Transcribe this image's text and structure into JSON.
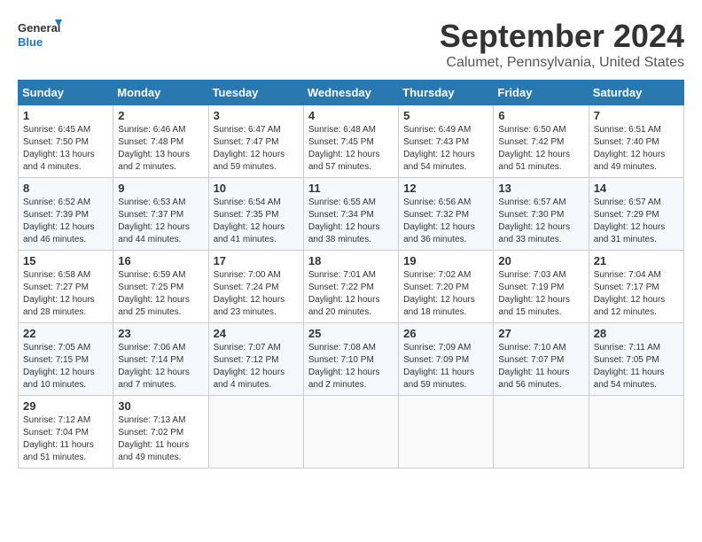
{
  "logo": {
    "line1": "General",
    "line2": "Blue"
  },
  "title": "September 2024",
  "location": "Calumet, Pennsylvania, United States",
  "days_of_week": [
    "Sunday",
    "Monday",
    "Tuesday",
    "Wednesday",
    "Thursday",
    "Friday",
    "Saturday"
  ],
  "weeks": [
    [
      {
        "day": "1",
        "sunrise": "6:45 AM",
        "sunset": "7:50 PM",
        "daylight": "13 hours and 4 minutes."
      },
      {
        "day": "2",
        "sunrise": "6:46 AM",
        "sunset": "7:48 PM",
        "daylight": "13 hours and 2 minutes."
      },
      {
        "day": "3",
        "sunrise": "6:47 AM",
        "sunset": "7:47 PM",
        "daylight": "12 hours and 59 minutes."
      },
      {
        "day": "4",
        "sunrise": "6:48 AM",
        "sunset": "7:45 PM",
        "daylight": "12 hours and 57 minutes."
      },
      {
        "day": "5",
        "sunrise": "6:49 AM",
        "sunset": "7:43 PM",
        "daylight": "12 hours and 54 minutes."
      },
      {
        "day": "6",
        "sunrise": "6:50 AM",
        "sunset": "7:42 PM",
        "daylight": "12 hours and 51 minutes."
      },
      {
        "day": "7",
        "sunrise": "6:51 AM",
        "sunset": "7:40 PM",
        "daylight": "12 hours and 49 minutes."
      }
    ],
    [
      {
        "day": "8",
        "sunrise": "6:52 AM",
        "sunset": "7:39 PM",
        "daylight": "12 hours and 46 minutes."
      },
      {
        "day": "9",
        "sunrise": "6:53 AM",
        "sunset": "7:37 PM",
        "daylight": "12 hours and 44 minutes."
      },
      {
        "day": "10",
        "sunrise": "6:54 AM",
        "sunset": "7:35 PM",
        "daylight": "12 hours and 41 minutes."
      },
      {
        "day": "11",
        "sunrise": "6:55 AM",
        "sunset": "7:34 PM",
        "daylight": "12 hours and 38 minutes."
      },
      {
        "day": "12",
        "sunrise": "6:56 AM",
        "sunset": "7:32 PM",
        "daylight": "12 hours and 36 minutes."
      },
      {
        "day": "13",
        "sunrise": "6:57 AM",
        "sunset": "7:30 PM",
        "daylight": "12 hours and 33 minutes."
      },
      {
        "day": "14",
        "sunrise": "6:57 AM",
        "sunset": "7:29 PM",
        "daylight": "12 hours and 31 minutes."
      }
    ],
    [
      {
        "day": "15",
        "sunrise": "6:58 AM",
        "sunset": "7:27 PM",
        "daylight": "12 hours and 28 minutes."
      },
      {
        "day": "16",
        "sunrise": "6:59 AM",
        "sunset": "7:25 PM",
        "daylight": "12 hours and 25 minutes."
      },
      {
        "day": "17",
        "sunrise": "7:00 AM",
        "sunset": "7:24 PM",
        "daylight": "12 hours and 23 minutes."
      },
      {
        "day": "18",
        "sunrise": "7:01 AM",
        "sunset": "7:22 PM",
        "daylight": "12 hours and 20 minutes."
      },
      {
        "day": "19",
        "sunrise": "7:02 AM",
        "sunset": "7:20 PM",
        "daylight": "12 hours and 18 minutes."
      },
      {
        "day": "20",
        "sunrise": "7:03 AM",
        "sunset": "7:19 PM",
        "daylight": "12 hours and 15 minutes."
      },
      {
        "day": "21",
        "sunrise": "7:04 AM",
        "sunset": "7:17 PM",
        "daylight": "12 hours and 12 minutes."
      }
    ],
    [
      {
        "day": "22",
        "sunrise": "7:05 AM",
        "sunset": "7:15 PM",
        "daylight": "12 hours and 10 minutes."
      },
      {
        "day": "23",
        "sunrise": "7:06 AM",
        "sunset": "7:14 PM",
        "daylight": "12 hours and 7 minutes."
      },
      {
        "day": "24",
        "sunrise": "7:07 AM",
        "sunset": "7:12 PM",
        "daylight": "12 hours and 4 minutes."
      },
      {
        "day": "25",
        "sunrise": "7:08 AM",
        "sunset": "7:10 PM",
        "daylight": "12 hours and 2 minutes."
      },
      {
        "day": "26",
        "sunrise": "7:09 AM",
        "sunset": "7:09 PM",
        "daylight": "11 hours and 59 minutes."
      },
      {
        "day": "27",
        "sunrise": "7:10 AM",
        "sunset": "7:07 PM",
        "daylight": "11 hours and 56 minutes."
      },
      {
        "day": "28",
        "sunrise": "7:11 AM",
        "sunset": "7:05 PM",
        "daylight": "11 hours and 54 minutes."
      }
    ],
    [
      {
        "day": "29",
        "sunrise": "7:12 AM",
        "sunset": "7:04 PM",
        "daylight": "11 hours and 51 minutes."
      },
      {
        "day": "30",
        "sunrise": "7:13 AM",
        "sunset": "7:02 PM",
        "daylight": "11 hours and 49 minutes."
      },
      null,
      null,
      null,
      null,
      null
    ]
  ]
}
